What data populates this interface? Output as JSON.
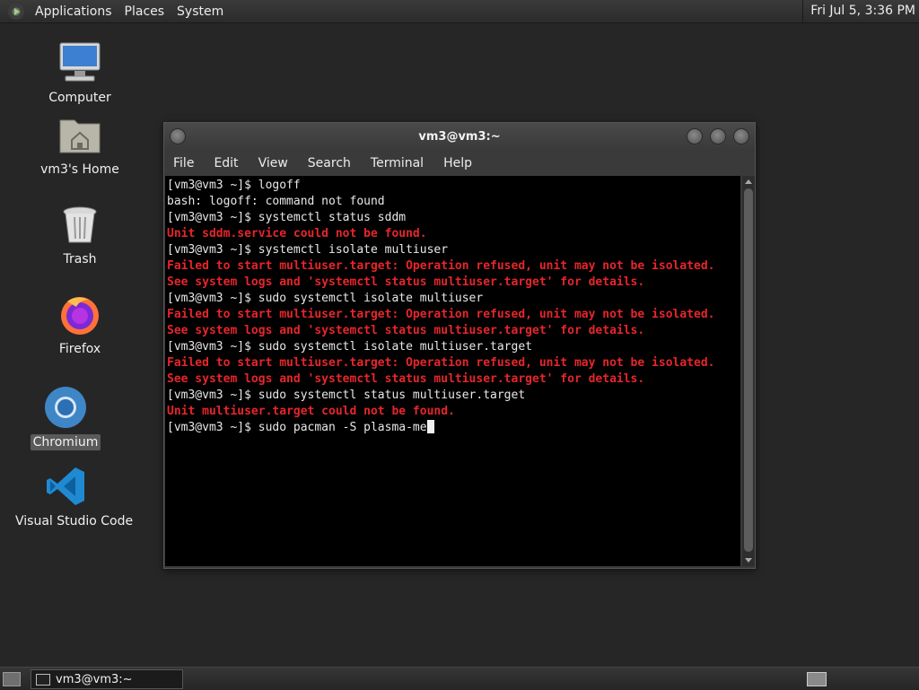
{
  "top_panel": {
    "menus": [
      "Applications",
      "Places",
      "System"
    ],
    "clock": "Fri Jul  5,  3:36 PM"
  },
  "desktop_icons": [
    {
      "label": "Computer",
      "icon": "computer-icon"
    },
    {
      "label": "vm3's Home",
      "icon": "home-folder-icon"
    },
    {
      "label": "Trash",
      "icon": "trash-icon"
    },
    {
      "label": "Firefox",
      "icon": "firefox-icon"
    },
    {
      "label": "Chromium",
      "icon": "chromium-icon",
      "selected": true
    },
    {
      "label": "Visual Studio Code",
      "icon": "vscode-icon"
    }
  ],
  "terminal": {
    "title": "vm3@vm3:~",
    "menu": [
      "File",
      "Edit",
      "View",
      "Search",
      "Terminal",
      "Help"
    ],
    "lines": [
      {
        "text": "[vm3@vm3 ~]$ logoff",
        "type": "normal"
      },
      {
        "text": "bash: logoff: command not found",
        "type": "normal"
      },
      {
        "text": "[vm3@vm3 ~]$ systemctl status sddm",
        "type": "normal"
      },
      {
        "text": "Unit sddm.service could not be found.",
        "type": "error"
      },
      {
        "text": "[vm3@vm3 ~]$ systemctl isolate multiuser",
        "type": "normal"
      },
      {
        "text": "Failed to start multiuser.target: Operation refused, unit may not be isolated.",
        "type": "error"
      },
      {
        "text": "See system logs and 'systemctl status multiuser.target' for details.",
        "type": "error"
      },
      {
        "text": "[vm3@vm3 ~]$ sudo systemctl isolate multiuser",
        "type": "normal"
      },
      {
        "text": "Failed to start multiuser.target: Operation refused, unit may not be isolated.",
        "type": "error"
      },
      {
        "text": "See system logs and 'systemctl status multiuser.target' for details.",
        "type": "error"
      },
      {
        "text": "[vm3@vm3 ~]$ sudo systemctl isolate multiuser.target",
        "type": "normal"
      },
      {
        "text": "Failed to start multiuser.target: Operation refused, unit may not be isolated.",
        "type": "error"
      },
      {
        "text": "See system logs and 'systemctl status multiuser.target' for details.",
        "type": "error"
      },
      {
        "text": "[vm3@vm3 ~]$ sudo systemctl status multiuser.target",
        "type": "normal"
      },
      {
        "text": "Unit multiuser.target could not be found.",
        "type": "error"
      },
      {
        "text": "[vm3@vm3 ~]$ sudo pacman -S plasma-me",
        "type": "normal",
        "cursor": true
      }
    ]
  },
  "taskbar": {
    "task_label": "vm3@vm3:~"
  },
  "colors": {
    "error": "#e5262b",
    "terminal_bg": "#000000",
    "desktop_bg": "#262626"
  }
}
